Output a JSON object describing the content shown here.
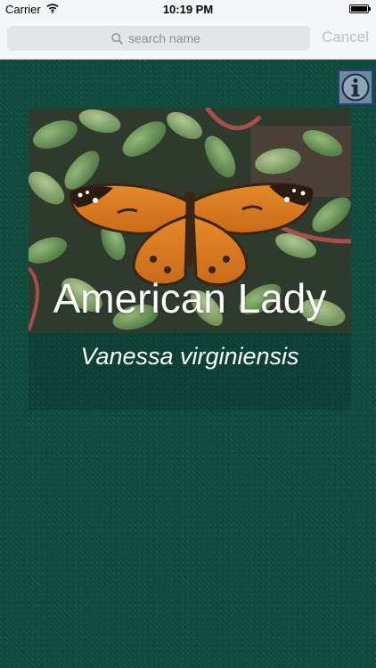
{
  "status_bar": {
    "carrier": "Carrier",
    "time": "10:19 PM",
    "icons": [
      "wifi-icon",
      "battery-icon"
    ]
  },
  "search": {
    "placeholder": "search name",
    "value": "",
    "cancel_label": "Cancel",
    "icon": "search-icon"
  },
  "info_button": {
    "icon": "info-icon"
  },
  "species": {
    "common_name": "American Lady",
    "scientific_name": "Vanessa virginiensis"
  },
  "colors": {
    "background": "#0d4a3c",
    "search_bar_bg": "#f6f7f8",
    "cancel_text": "#b7c3cf",
    "info_button_bg": "#6e8aa0",
    "info_button_border": "#2a3f7a",
    "title_text": "#ffffff"
  }
}
